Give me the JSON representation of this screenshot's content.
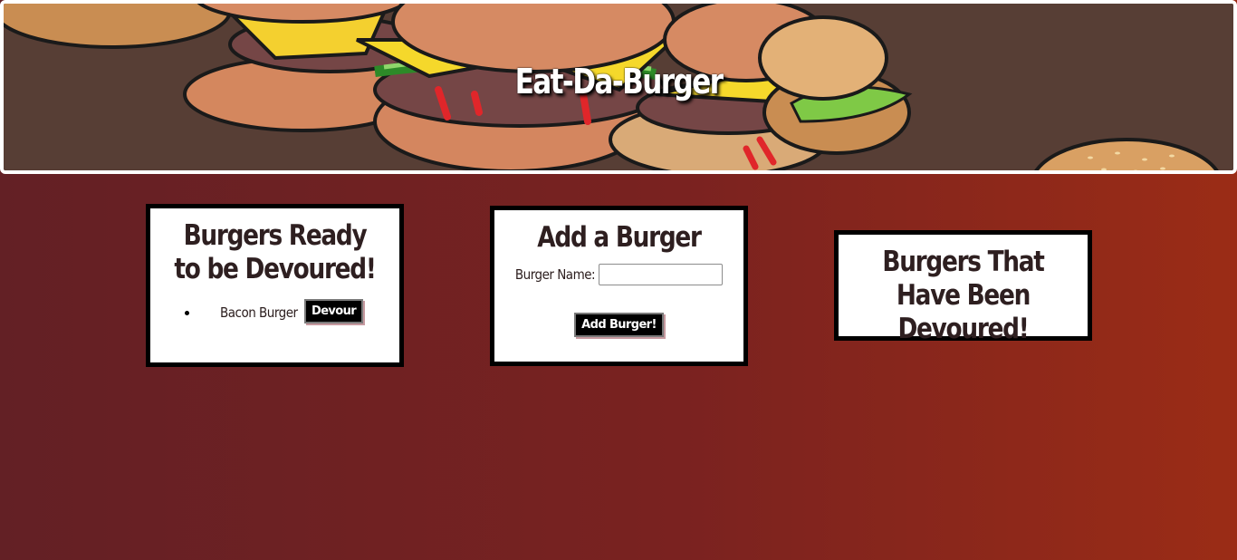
{
  "header": {
    "title": "Eat-Da-Burger"
  },
  "ready_card": {
    "title": "Burgers Ready to be Devoured!",
    "burgers": [
      {
        "name": "Bacon Burger",
        "button_label": "Devour"
      }
    ]
  },
  "add_card": {
    "title": "Add a Burger",
    "field_label": "Burger Name:",
    "field_value": "",
    "field_placeholder": "",
    "submit_label": "Add Burger!"
  },
  "devoured_card": {
    "title": "Burgers That Have Been Devoured!"
  },
  "colors": {
    "background_start": "#632025",
    "background_end": "#9b2c16",
    "banner_bg": "#573e35",
    "card_border": "#000000",
    "button_bg": "#000000"
  }
}
